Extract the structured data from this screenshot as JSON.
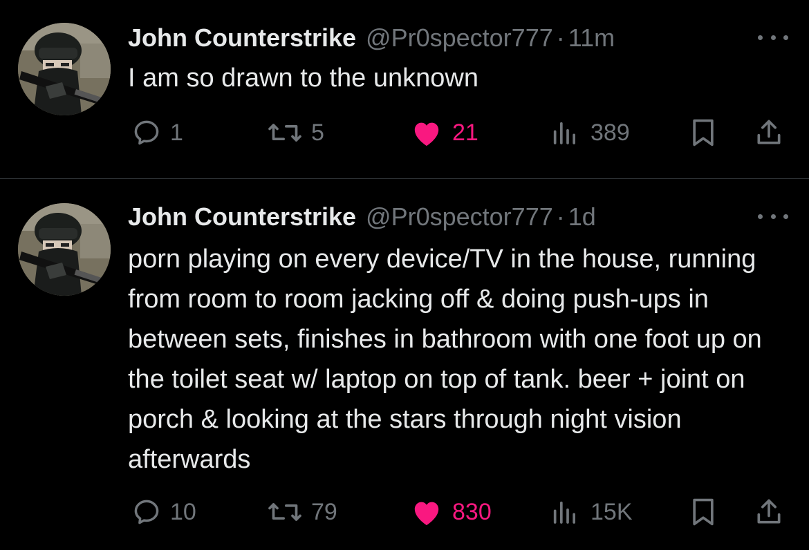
{
  "tweets": [
    {
      "name": "John Counterstrike",
      "handle": "@Pr0spector777",
      "separator": "·",
      "time": "11m",
      "text": "I am so drawn to the unknown",
      "replies": "1",
      "reposts": "5",
      "likes": "21",
      "views": "389",
      "liked": true
    },
    {
      "name": "John Counterstrike",
      "handle": "@Pr0spector777",
      "separator": "·",
      "time": "1d",
      "text": "porn playing on every device/TV in the house, running from room to room jacking off & doing push-ups in between sets, finishes in bathroom with one foot up on the toilet seat w/ laptop on top of tank. beer + joint on porch & looking at the stars through night vision afterwards",
      "replies": "10",
      "reposts": "79",
      "likes": "830",
      "views": "15K",
      "liked": true
    }
  ],
  "icons": {
    "reply": "reply-icon",
    "repost": "repost-icon",
    "like": "heart-icon",
    "views": "views-icon",
    "bookmark": "bookmark-icon",
    "share": "share-icon",
    "more": "more-icon"
  },
  "colors": {
    "background": "#000000",
    "text": "#e7e9ea",
    "muted": "#71767b",
    "like": "#f91880",
    "divider": "#2f3336"
  }
}
